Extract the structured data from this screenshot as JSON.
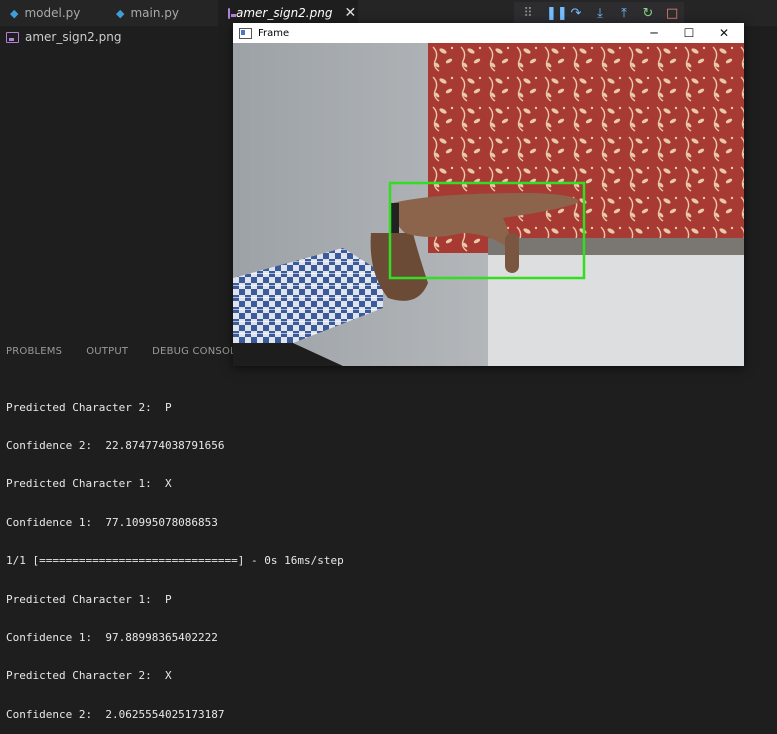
{
  "tabs": [
    {
      "label": "model.py",
      "icon": "python-icon",
      "active": false
    },
    {
      "label": "main.py",
      "icon": "python-icon",
      "active": false
    },
    {
      "label": "amer_sign2.png",
      "icon": "image-icon",
      "active": true
    }
  ],
  "close_glyph": "✕",
  "breadcrumb": {
    "file": "amer_sign2.png"
  },
  "debug_toolbar": [
    "drag-handle-icon",
    "pause-icon",
    "step-over-icon",
    "step-into-icon",
    "step-out-icon",
    "restart-icon",
    "stop-icon"
  ],
  "panel_tabs": [
    "PROBLEMS",
    "OUTPUT",
    "DEBUG CONSOLE"
  ],
  "frame_window": {
    "title": "Frame",
    "controls": {
      "minimize": "─",
      "maximize": "☐",
      "close": "✕"
    },
    "detection_box_color": "#33dd22"
  },
  "terminal_lines": [
    "Predicted Character 2:  P",
    "Confidence 2:  22.874774038791656",
    "Predicted Character 1:  X",
    "Confidence 1:  77.10995078086853",
    "1/1 [==============================] - 0s 16ms/step",
    "Predicted Character 1:  P",
    "Confidence 1:  97.88998365402222",
    "Predicted Character 2:  X",
    "Confidence 2:  2.0625554025173187"
  ]
}
